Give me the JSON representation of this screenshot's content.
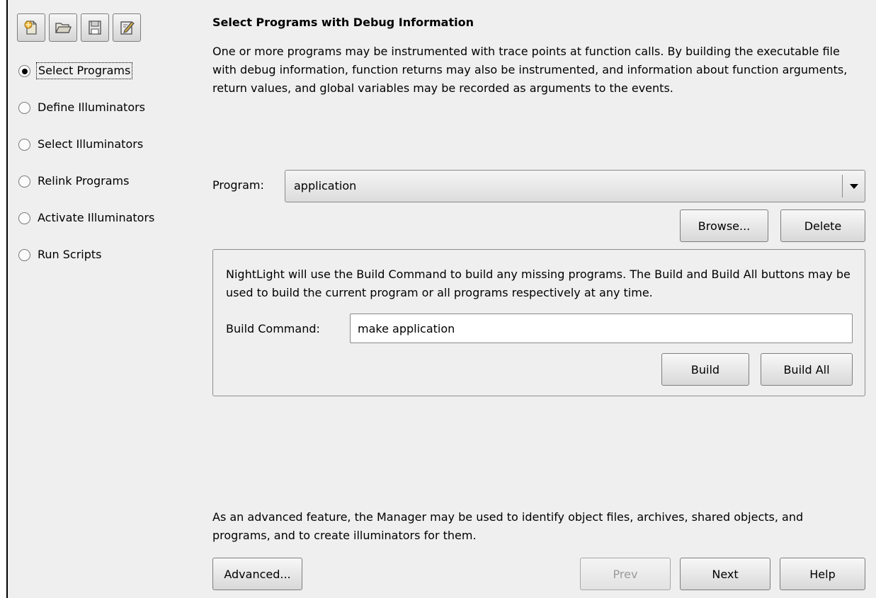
{
  "toolbar": {
    "icons": [
      "new-project-icon",
      "open-folder-icon",
      "save-icon",
      "edit-icon"
    ]
  },
  "steps": [
    {
      "label": "Select Programs",
      "selected": true
    },
    {
      "label": "Define Illuminators",
      "selected": false
    },
    {
      "label": "Select Illuminators",
      "selected": false
    },
    {
      "label": "Relink Programs",
      "selected": false
    },
    {
      "label": "Activate Illuminators",
      "selected": false
    },
    {
      "label": "Run Scripts",
      "selected": false
    }
  ],
  "main": {
    "heading": "Select Programs with Debug Information",
    "intro": "One or more programs may be instrumented with trace points at function calls. By building the executable file with debug information, function returns may also be instrumented, and information about function arguments, return values, and global variables may be recorded as arguments to the events.",
    "program_label": "Program:",
    "program_value": "application",
    "browse_label": "Browse...",
    "delete_label": "Delete",
    "build": {
      "description": "NightLight will use the Build Command to build any missing programs. The Build and Build All buttons may be used to build the current program or all programs respectively at any time.",
      "command_label": "Build Command:",
      "command_value": "make application",
      "build_label": "Build",
      "build_all_label": "Build All"
    },
    "footer_text": "As an advanced feature, the Manager may be used to identify object files, archives, shared objects, and programs, and to create illuminators for them.",
    "advanced_label": "Advanced...",
    "prev_label": "Prev",
    "next_label": "Next",
    "help_label": "Help"
  }
}
